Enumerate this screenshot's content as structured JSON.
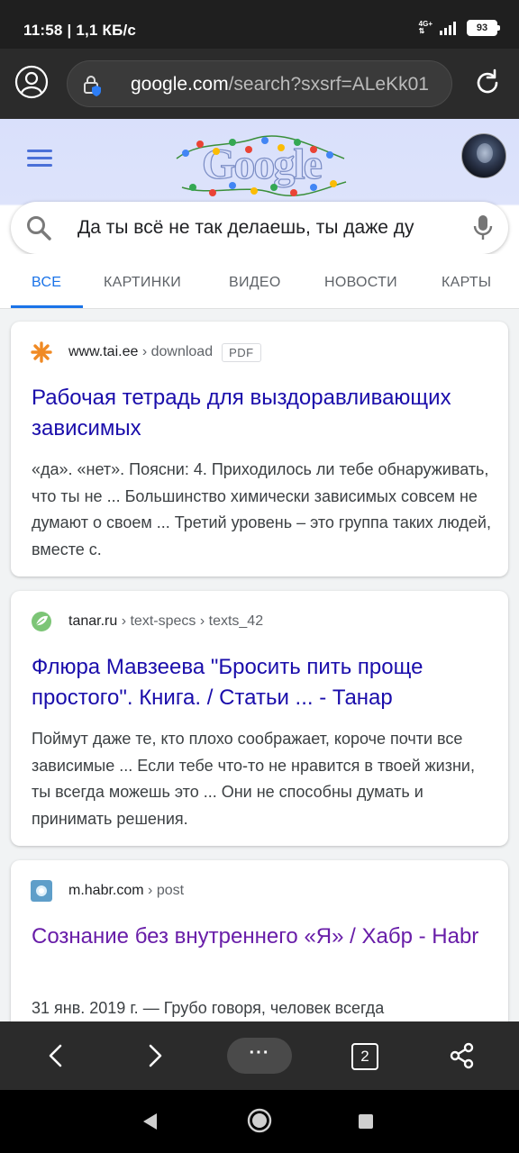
{
  "status": {
    "time": "11:58 | 1,1 КБ/с",
    "network": "4G+",
    "battery": "93"
  },
  "browser": {
    "url_host": "google.com",
    "url_path": "/search?sxsrf=ALeKk01",
    "tabs_count": "2",
    "menu_label": "···"
  },
  "search": {
    "logo_text": "Google",
    "query": "Да ты всё не так делаешь, ты даже ду",
    "tabs": [
      {
        "label": "ВСЕ",
        "active": true
      },
      {
        "label": "КАРТИНКИ"
      },
      {
        "label": "ВИДЕО"
      },
      {
        "label": "НОВОСТИ"
      },
      {
        "label": "КАРТЫ"
      }
    ]
  },
  "results": [
    {
      "site": "www.tai.ee",
      "path": " › download",
      "badge": "PDF",
      "title": "Рабочая тетрадь для выздоравливающих зависимых",
      "snippet": "«да». «нет». Поясни: 4. Приходилось ли тебе обнаруживать, что ты не ... Большинство химически зависимых совсем не думают о своем ... Третий уровень – это группа таких людей, вместе с."
    },
    {
      "site": "tanar.ru",
      "path": " › text-specs › texts_42",
      "title": "Флюра Мавзеева \"Бросить пить проще простого\". Книга. / Статьи ... - Танар",
      "snippet": "Поймут даже те, кто плохо соображает, короче почти все зависимые ... Если тебе что-то не нравится в твоей жизни, ты всегда можешь это ... Они не способны думать и принимать решения."
    },
    {
      "site": "m.habr.com",
      "path": " › post",
      "title": "Сознание без внутреннего «Я» / Хабр - Habr",
      "snippet": "31 янв. 2019 г. — Грубо говоря, человек всегда"
    }
  ],
  "colors": {
    "link": "#1a0dab",
    "visited": "#681da8",
    "accent": "#1a73e8"
  }
}
